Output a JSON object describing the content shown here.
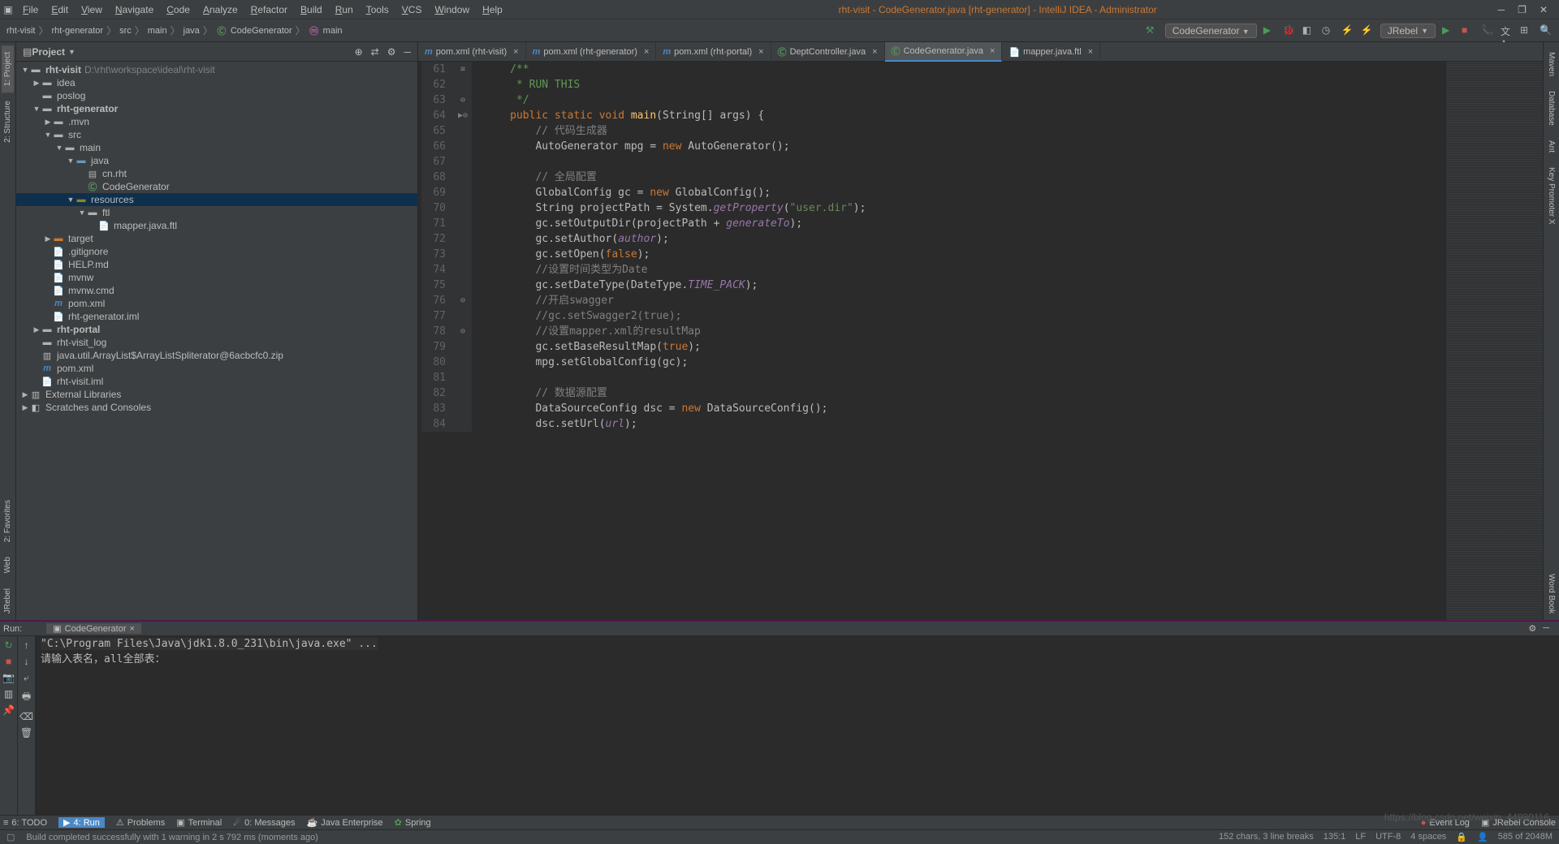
{
  "menu": [
    "File",
    "Edit",
    "View",
    "Navigate",
    "Code",
    "Analyze",
    "Refactor",
    "Build",
    "Run",
    "Tools",
    "VCS",
    "Window",
    "Help"
  ],
  "title": {
    "text": "rht-visit - CodeGenerator.java [rht-generator] - IntelliJ IDEA - Administrator"
  },
  "breadcrumb": [
    "rht-visit",
    "rht-generator",
    "src",
    "main",
    "java",
    "CodeGenerator",
    "main"
  ],
  "run_config": "CodeGenerator",
  "jrebel": "JRebel",
  "left_gutter": [
    "1: Project",
    "2: Structure",
    "2: Favorites",
    "Web",
    "JRebel"
  ],
  "right_gutter": [
    "Maven",
    "Database",
    "Ant",
    "Key Promoter X",
    "Word Book"
  ],
  "project_panel": {
    "title": "Project"
  },
  "tree": {
    "root": {
      "label": "rht-visit",
      "path": "D:\\rht\\workspace\\ideal\\rht-visit"
    },
    "items": [
      "idea",
      ".mvn",
      "poslog",
      "rht-generator",
      "src",
      "main",
      "java",
      "cn.rht",
      "CodeGenerator",
      "resources",
      "ftl",
      "mapper.java.ftl",
      "target",
      ".gitignore",
      "HELP.md",
      "mvnw",
      "mvnw.cmd",
      "pom.xml",
      "rht-generator.iml",
      "rht-portal",
      "rht-visit_log",
      "java.util.ArrayList$ArrayListSpliterator@6acbcfc0.zip",
      "pom.xml",
      "rht-visit.iml",
      "External Libraries",
      "Scratches and Consoles"
    ]
  },
  "tabs": [
    {
      "label": "pom.xml (rht-visit)",
      "active": false
    },
    {
      "label": "pom.xml (rht-generator)",
      "active": false
    },
    {
      "label": "pom.xml (rht-portal)",
      "active": false
    },
    {
      "label": "DeptController.java",
      "active": false
    },
    {
      "label": "CodeGenerator.java",
      "active": true
    },
    {
      "label": "mapper.java.ftl",
      "active": false
    }
  ],
  "code_lines": [
    {
      "n": 61,
      "m": "≡",
      "h": "     <span class='doc'>/**</span>"
    },
    {
      "n": 62,
      "m": "",
      "h": "<span class='doc'>      * RUN THIS</span>"
    },
    {
      "n": 63,
      "m": "⊖",
      "h": "<span class='doc'>      */</span>"
    },
    {
      "n": 64,
      "m": "▶⊖",
      "h": "     <span class='kw'>public static void</span> <span class='fn'>main</span>(String[] args) {"
    },
    {
      "n": 65,
      "m": "",
      "h": "         <span class='cmt'>// 代码生成器</span>"
    },
    {
      "n": 66,
      "m": "",
      "h": "         AutoGenerator mpg = <span class='kw'>new</span> AutoGenerator();"
    },
    {
      "n": 67,
      "m": "",
      "h": ""
    },
    {
      "n": 68,
      "m": "",
      "h": "         <span class='cmt'>// 全局配置</span>"
    },
    {
      "n": 69,
      "m": "",
      "h": "         GlobalConfig gc = <span class='kw'>new</span> GlobalConfig();"
    },
    {
      "n": 70,
      "m": "",
      "h": "         String projectPath = System.<span class='fld'>getProperty</span>(<span class='str'>\"user.dir\"</span>);"
    },
    {
      "n": 71,
      "m": "",
      "h": "         gc.setOutputDir(projectPath + <span class='fld'>generateTo</span>);"
    },
    {
      "n": 72,
      "m": "",
      "h": "         gc.setAuthor(<span class='fld'>author</span>);"
    },
    {
      "n": 73,
      "m": "",
      "h": "         gc.setOpen(<span class='kw'>false</span>);"
    },
    {
      "n": 74,
      "m": "",
      "h": "         <span class='cmt'>//设置时间类型为Date</span>"
    },
    {
      "n": 75,
      "m": "",
      "h": "         gc.setDateType(DateType.<span class='fld'>TIME_PACK</span>);"
    },
    {
      "n": 76,
      "m": "⊖",
      "h": "         <span class='cmt'>//开启swagger</span>"
    },
    {
      "n": 77,
      "m": "",
      "h": "         <span class='cmt'>//gc.setSwagger2(true);</span>"
    },
    {
      "n": 78,
      "m": "⊖",
      "h": "         <span class='cmt'>//设置mapper.xml的resultMap</span>"
    },
    {
      "n": 79,
      "m": "",
      "h": "         gc.setBaseResultMap(<span class='kw'>true</span>);"
    },
    {
      "n": 80,
      "m": "",
      "h": "         mpg.setGlobalConfig(gc);"
    },
    {
      "n": 81,
      "m": "",
      "h": ""
    },
    {
      "n": 82,
      "m": "",
      "h": "         <span class='cmt'>// 数据源配置</span>"
    },
    {
      "n": 83,
      "m": "",
      "h": "         DataSourceConfig dsc = <span class='kw'>new</span> DataSourceConfig();"
    },
    {
      "n": 84,
      "m": "",
      "h": "         dsc.setUrl(<span class='fld'>url</span>);"
    }
  ],
  "run_panel": {
    "label": "Run:",
    "tab": "CodeGenerator",
    "line1": "\"C:\\Program Files\\Java\\jdk1.8.0_231\\bin\\java.exe\" ...",
    "line2": "请输入表名，all全部表："
  },
  "bottom_buttons": [
    "6: TODO",
    "4: Run",
    "Problems",
    "Terminal",
    "0: Messages",
    "Java Enterprise",
    "Spring"
  ],
  "bottom_right": {
    "event_log": "Event Log",
    "jrebel": "JRebel Console"
  },
  "status": {
    "build": "Build completed successfully with 1 warning in 2 s 792 ms (moments ago)",
    "sel": "152 chars, 3 line breaks",
    "pos": "135:1",
    "le": "LF",
    "enc": "UTF-8",
    "indent": "4 spaces",
    "mem": "585 of 2048M"
  },
  "watermark": "https://blog.csdn.net/weixin_44980116"
}
